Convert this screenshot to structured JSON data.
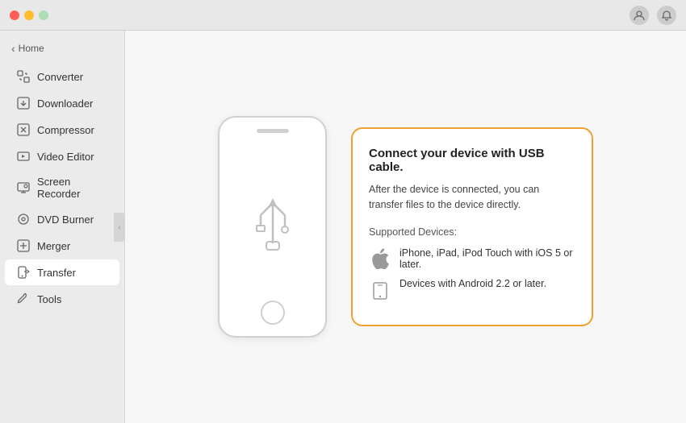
{
  "titleBar": {
    "userIconLabel": "user",
    "notificationIconLabel": "notification"
  },
  "sidebar": {
    "homeLabel": "Home",
    "items": [
      {
        "id": "converter",
        "label": "Converter",
        "icon": "converter"
      },
      {
        "id": "downloader",
        "label": "Downloader",
        "icon": "downloader"
      },
      {
        "id": "compressor",
        "label": "Compressor",
        "icon": "compressor"
      },
      {
        "id": "video-editor",
        "label": "Video Editor",
        "icon": "video-editor"
      },
      {
        "id": "screen-recorder",
        "label": "Screen Recorder",
        "icon": "screen-recorder"
      },
      {
        "id": "dvd-burner",
        "label": "DVD Burner",
        "icon": "dvd-burner"
      },
      {
        "id": "merger",
        "label": "Merger",
        "icon": "merger"
      },
      {
        "id": "transfer",
        "label": "Transfer",
        "icon": "transfer",
        "active": true
      },
      {
        "id": "tools",
        "label": "Tools",
        "icon": "tools"
      }
    ]
  },
  "transferPage": {
    "infoBox": {
      "title": "Connect your device with USB cable.",
      "description": "After the device is connected, you can transfer files to the device directly.",
      "supportedLabel": "Supported Devices:",
      "devices": [
        {
          "label": "iPhone, iPad, iPod Touch with iOS 5 or later."
        },
        {
          "label": "Devices with Android 2.2 or later."
        }
      ]
    }
  }
}
